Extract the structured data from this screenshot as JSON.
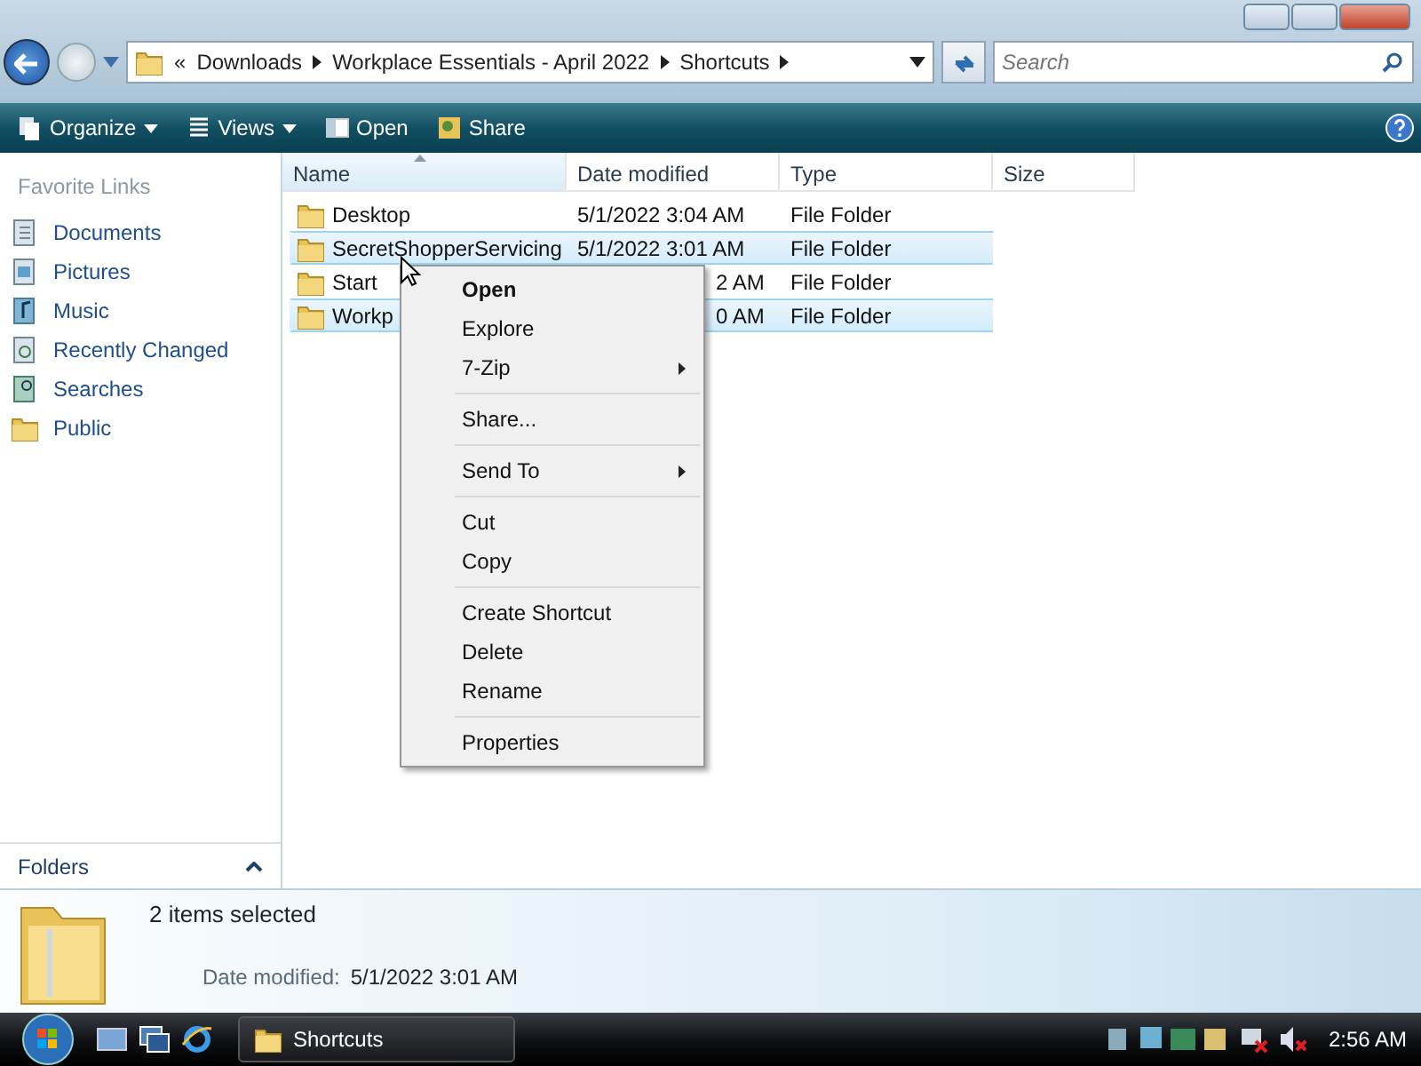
{
  "address_bar": {
    "crumbs": [
      "«",
      "Downloads",
      "Workplace Essentials - April 2022",
      "Shortcuts"
    ]
  },
  "search": {
    "placeholder": "Search"
  },
  "toolbar": [
    "Organize",
    "Views",
    "Open",
    "Share"
  ],
  "sidebar": {
    "title": "Favorite Links",
    "items": [
      "Documents",
      "Pictures",
      "Music",
      "Recently Changed",
      "Searches",
      "Public"
    ],
    "footer": "Folders"
  },
  "file_list": {
    "columns": [
      "Name",
      "Date modified",
      "Type",
      "Size"
    ],
    "rows": [
      {
        "name": "Desktop",
        "date": "5/1/2022 3:04 AM",
        "type": "File Folder",
        "selected": false,
        "covered": false
      },
      {
        "name": "SecretShopperServicing",
        "date": "5/1/2022 3:01 AM",
        "type": "File Folder",
        "selected": true,
        "covered": false
      },
      {
        "name": "Start",
        "date": "2 AM",
        "type": "File Folder",
        "selected": false,
        "covered": true
      },
      {
        "name": "Workp",
        "date": "0 AM",
        "type": "File Folder",
        "selected": true,
        "covered": true
      }
    ]
  },
  "context_menu": {
    "groups": [
      [
        {
          "label": "Open",
          "default": true,
          "submenu": false
        },
        {
          "label": "Explore",
          "default": false,
          "submenu": false
        },
        {
          "label": "7-Zip",
          "default": false,
          "submenu": true
        }
      ],
      [
        {
          "label": "Share...",
          "default": false,
          "submenu": false
        }
      ],
      [
        {
          "label": "Send To",
          "default": false,
          "submenu": true
        }
      ],
      [
        {
          "label": "Cut",
          "default": false,
          "submenu": false
        },
        {
          "label": "Copy",
          "default": false,
          "submenu": false
        }
      ],
      [
        {
          "label": "Create Shortcut",
          "default": false,
          "submenu": false
        },
        {
          "label": "Delete",
          "default": false,
          "submenu": false
        },
        {
          "label": "Rename",
          "default": false,
          "submenu": false
        }
      ],
      [
        {
          "label": "Properties",
          "default": false,
          "submenu": false
        }
      ]
    ]
  },
  "details_pane": {
    "summary": "2 items selected",
    "field_label": "Date modified:",
    "field_value": "5/1/2022 3:01 AM"
  },
  "taskbar": {
    "task": "Shortcuts",
    "clock": "2:56 AM"
  }
}
